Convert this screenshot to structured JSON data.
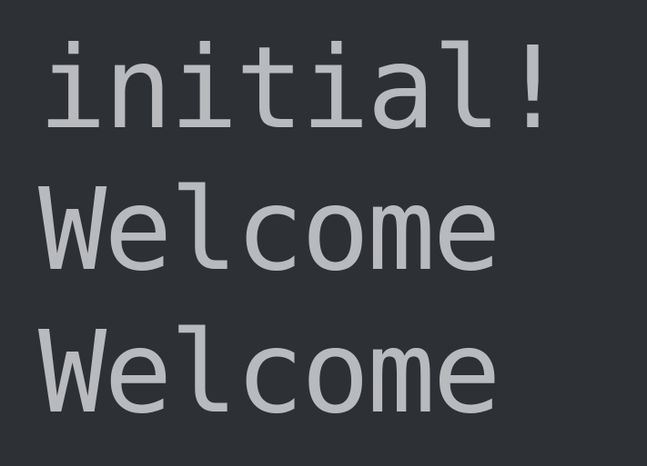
{
  "terminal": {
    "lines": [
      "initial!",
      "Welcome",
      "Welcome"
    ]
  }
}
